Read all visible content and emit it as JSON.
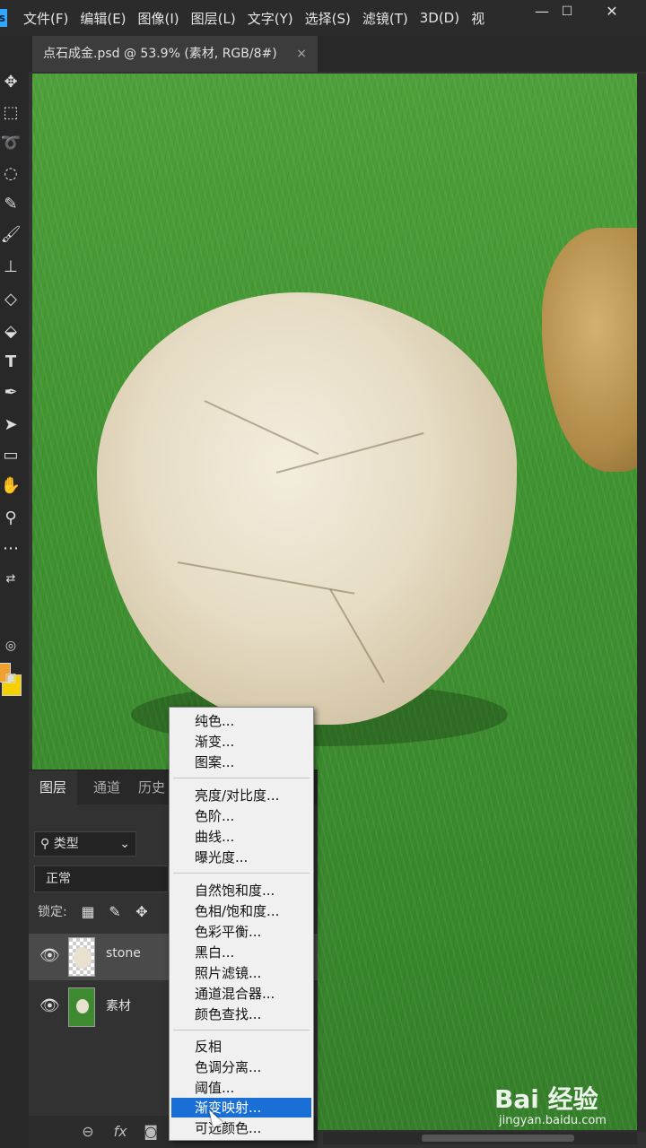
{
  "app": {
    "logo": "s"
  },
  "menubar": {
    "items": [
      "文件(F)",
      "编辑(E)",
      "图像(I)",
      "图层(L)",
      "文字(Y)",
      "选择(S)",
      "滤镜(T)",
      "3D(D)",
      "视"
    ],
    "minimize": "—",
    "maximize": "☐",
    "close": "✕"
  },
  "document_tab": {
    "title": "点石成金.psd @ 53.9% (素材, RGB/8#)",
    "close": "×"
  },
  "toolbar": {
    "text_tool": "T"
  },
  "layers_panel": {
    "tabs": [
      "图层",
      "通道",
      "历史"
    ],
    "filter_label": "类型",
    "blend_mode": "正常",
    "lock_label": "锁定:",
    "layers": [
      {
        "name": "stone",
        "visible": true,
        "selected": true
      },
      {
        "name": "素材",
        "visible": true,
        "selected": false
      }
    ],
    "footer": {
      "fx": "fx"
    }
  },
  "context_menu": {
    "groups": [
      [
        "纯色...",
        "渐变...",
        "图案..."
      ],
      [
        "亮度/对比度...",
        "色阶...",
        "曲线...",
        "曝光度..."
      ],
      [
        "自然饱和度...",
        "色相/饱和度...",
        "色彩平衡...",
        "黑白...",
        "照片滤镜...",
        "通道混合器...",
        "颜色查找..."
      ],
      [
        "反相",
        "色调分离...",
        "阈值...",
        "渐变映射...",
        "可选颜色..."
      ]
    ],
    "highlighted": "渐变映射..."
  },
  "watermark": {
    "brand": "Bai 经验",
    "url": "jingyan.baidu.com"
  },
  "colors": {
    "foreground": "#f0a030",
    "background": "#f5d000",
    "highlight": "#1a6fd6"
  }
}
